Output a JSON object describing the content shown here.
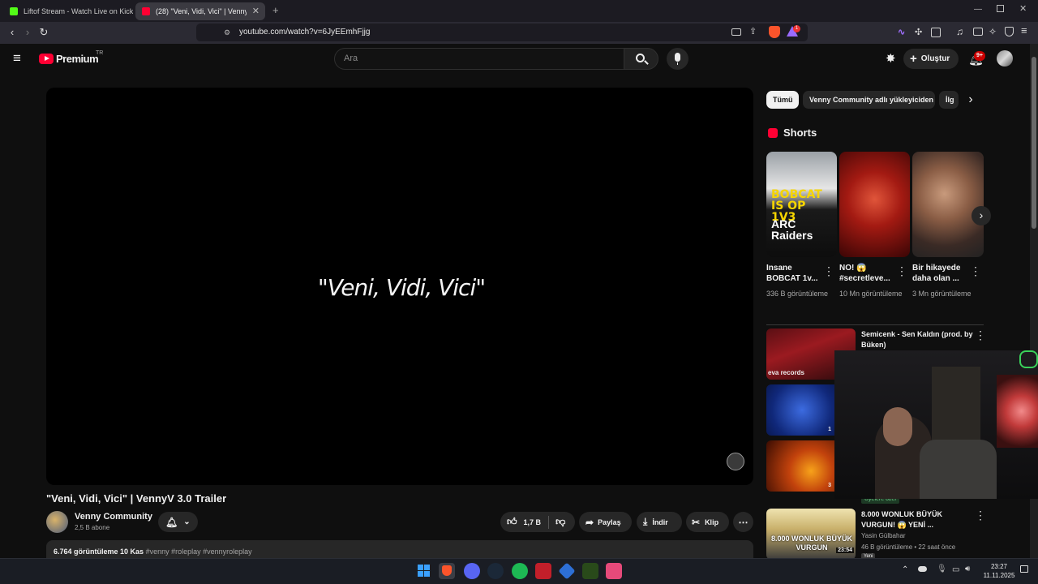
{
  "browser": {
    "tabs": [
      {
        "label": "Liftof Stream - Watch Live on Kick",
        "active": false
      },
      {
        "label": "(28) \"Veni, Vidi, Vici\" | VennyV 3.0",
        "active": true
      }
    ],
    "url": "youtube.com/watch?v=6JyEEmhFjjg",
    "brave_badge": "1"
  },
  "header": {
    "logo": "Premium",
    "logo_sup": "TR",
    "search_placeholder": "Ara",
    "create_label": "Oluştur",
    "notif_count": "9+"
  },
  "player": {
    "overlay_text": "\"Veni, Vidi, Vici\""
  },
  "video": {
    "title": "\"Veni, Vidi, Vici\" | VennyV 3.0 Trailer",
    "channel": "Venny Community",
    "subscribers": "2,5 B abone",
    "likes": "1,7 B",
    "share": "Paylaş",
    "download": "İndir",
    "clip": "Klip",
    "views_date": "6.764 görüntüleme  10 Kas",
    "tags": "#venny #roleplay #vennyroleplay"
  },
  "sidebar": {
    "chips": [
      "Tümü",
      "Venny Community adlı yükleyiciden",
      "İlg"
    ],
    "shorts_heading": "Shorts",
    "shorts": [
      {
        "title": "Insane BOBCAT 1v...",
        "views": "336 B görüntüleme",
        "thumb_text": "BOBCAT IS OP 1V3",
        "thumb_brand": "ARC Raiders"
      },
      {
        "title": "NO! 😱 #secretleve...",
        "views": "10 Mn görüntüleme"
      },
      {
        "title": "Bir hikayede daha olan ...",
        "views": "3 Mn görüntüleme"
      }
    ],
    "videos": [
      {
        "title": "Semicenk - Sen Kaldın (prod. by Büken)",
        "thumb_text": "eva records"
      },
      {
        "title": "",
        "duration": "1"
      },
      {
        "title": "",
        "duration": "3",
        "badge": "Üyelere özel"
      },
      {
        "title": "8.000 WONLUK BÜYÜK VURGUN! 😱 YENİ ...",
        "channel": "Yasin Gülbahar",
        "meta": "46 B görüntüleme • 22 saat önce",
        "duration": "23:54",
        "thumb_text": "8.000 WONLUK BÜYÜK VURGUN",
        "badge": "Yeni"
      }
    ]
  },
  "taskbar": {
    "time": "23:27",
    "date": "11.11.2025"
  }
}
